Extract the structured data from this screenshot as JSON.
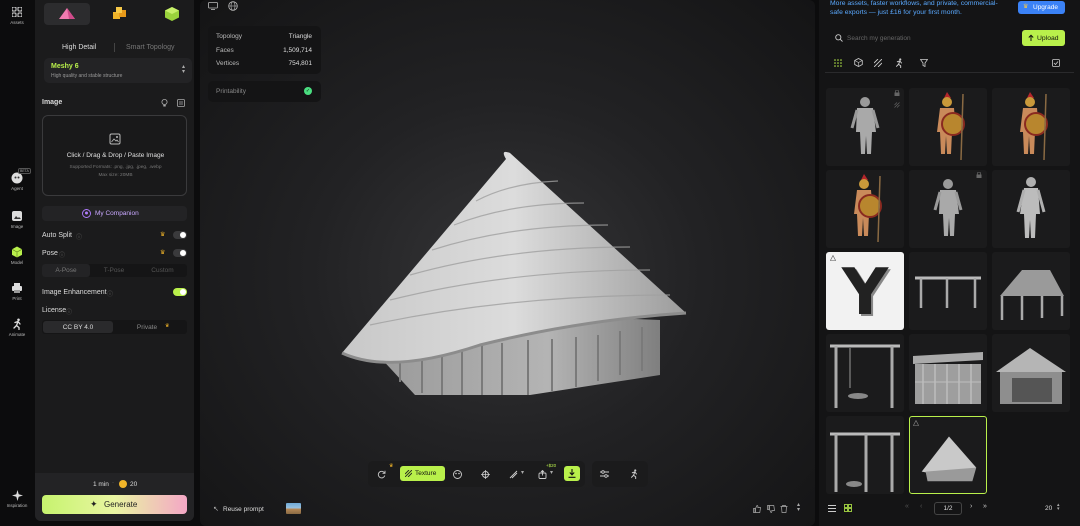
{
  "rail": {
    "items": [
      {
        "label": "Assets",
        "icon": "grid-icon"
      },
      {
        "label": "Agent",
        "icon": "agent-avatar-icon",
        "badge": "BETA"
      },
      {
        "label": "Image",
        "icon": "image-plus-icon"
      },
      {
        "label": "Model",
        "icon": "cube-icon"
      },
      {
        "label": "Print",
        "icon": "printer-icon"
      },
      {
        "label": "Animate",
        "icon": "running-figure-icon"
      },
      {
        "label": "Inspiration",
        "icon": "sparkle-icon"
      }
    ]
  },
  "left": {
    "mode_tabs": [
      "text-to-3d",
      "image-to-3d",
      "multi-image-to-3d"
    ],
    "detail_tabs": {
      "high": "High Detail",
      "smart": "Smart Topology"
    },
    "model": {
      "name": "Meshy 6",
      "desc": "High quality and stable structure"
    },
    "image_section": {
      "title": "Image"
    },
    "upload": {
      "title": "Click / Drag & Drop / Paste Image",
      "formats": "Supported Formats: .png, .jpg, .jpeg, .webp",
      "max": "Max size: 20MB"
    },
    "companion": "My Companion",
    "auto_split": "Auto Split",
    "pose": {
      "label": "Pose",
      "options": [
        "A-Pose",
        "T-Pose",
        "Custom"
      ]
    },
    "image_enhancement": "Image Enhancement",
    "license": {
      "label": "License",
      "options": [
        "CC BY 4.0",
        "Private"
      ]
    },
    "footer": {
      "time": "1 min",
      "credits": "20",
      "generate": "Generate"
    }
  },
  "viewport": {
    "stats": [
      {
        "label": "Topology",
        "value": "Triangle"
      },
      {
        "label": "Faces",
        "value": "1,509,714"
      },
      {
        "label": "Vertices",
        "value": "754,801"
      }
    ],
    "printability": "Printability",
    "toolbar": {
      "texture": "Texture",
      "credit_badge": "+$20"
    },
    "reuse_prompt": "Reuse prompt"
  },
  "right": {
    "promo": "More assets, faster workflows, and private, commercial-safe exports — just £16 for your first month.",
    "upgrade": "Upgrade",
    "search_placeholder": "Search my generation",
    "upload": "Upload",
    "pagination": {
      "page": "1/2",
      "per_page": "20"
    },
    "thumbnails": [
      {
        "kind": "grey-warrior"
      },
      {
        "kind": "spartan"
      },
      {
        "kind": "spartan"
      },
      {
        "kind": "spartan"
      },
      {
        "kind": "grey-warrior"
      },
      {
        "kind": "grey-figure"
      },
      {
        "kind": "letter",
        "text": "Y"
      },
      {
        "kind": "frame"
      },
      {
        "kind": "hut-frame"
      },
      {
        "kind": "frame-tall"
      },
      {
        "kind": "shed"
      },
      {
        "kind": "hut-open"
      },
      {
        "kind": "frame-tall"
      },
      {
        "kind": "hut-roof"
      }
    ]
  },
  "colors": {
    "accent": "#b9f04b",
    "crown": "#f0b429",
    "upgrade": "#3b82f6"
  }
}
